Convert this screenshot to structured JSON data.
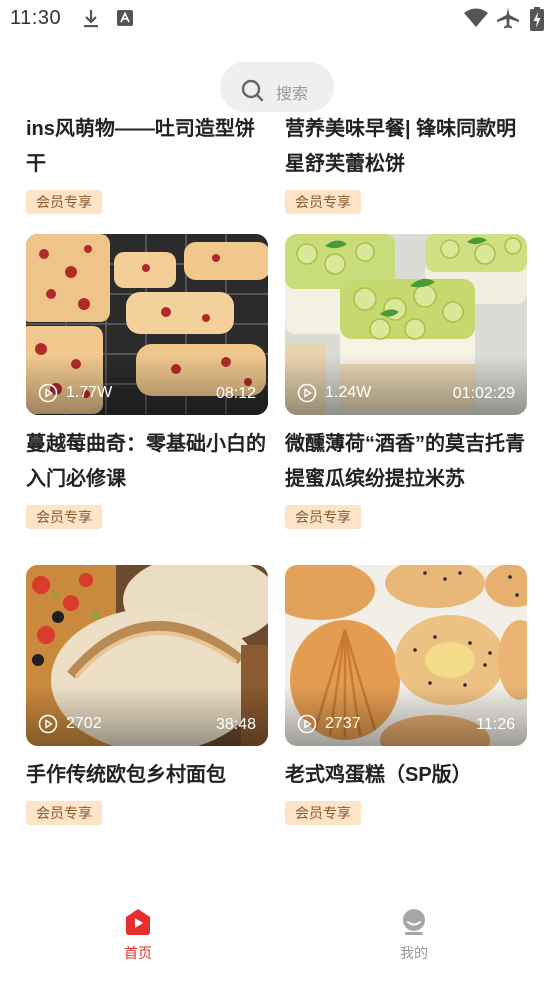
{
  "status_bar": {
    "time": "11:30",
    "icons": [
      "download-icon",
      "keyboard-a-icon",
      "wifi-icon",
      "airplane-mode-icon",
      "battery-charging-icon"
    ]
  },
  "search": {
    "label": "搜索",
    "icon": "search-icon"
  },
  "feed": {
    "cards": [
      {
        "title": "ins风萌物——吐司造型饼干",
        "badge": "会员专享"
      },
      {
        "title": "营养美味早餐| 锋味同款明星舒芙蕾松饼",
        "badge": "会员专享"
      },
      {
        "title": "蔓越莓曲奇：零基础小白的入门必修课",
        "badge": "会员专享",
        "views": "1.77W",
        "duration": "08:12",
        "image": "cranberry-cookies-on-rack"
      },
      {
        "title": "微醺薄荷“酒香”的莫吉托青提蜜瓜缤纷提拉米苏",
        "badge": "会员专享",
        "views": "1.24W",
        "duration": "01:02:29",
        "image": "green-grape-tiramisu-boxes"
      },
      {
        "title": "手作传统欧包乡村面包",
        "badge": "会员专享",
        "views": "2702",
        "duration": "38:48",
        "image": "rustic-country-bread"
      },
      {
        "title": "老式鸡蛋糕（SP版）",
        "badge": "会员专享",
        "views": "2737",
        "duration": "11:26",
        "image": "madeleine-egg-cakes"
      }
    ]
  },
  "bottom_nav": {
    "items": [
      {
        "label": "首页",
        "icon": "home-play-icon",
        "active": true
      },
      {
        "label": "我的",
        "icon": "profile-icon",
        "active": false
      }
    ]
  },
  "colors": {
    "accent": "#e62e2e",
    "badge_bg": "#fde3c8",
    "badge_text": "#8a5a2e",
    "inactive": "#999999"
  }
}
